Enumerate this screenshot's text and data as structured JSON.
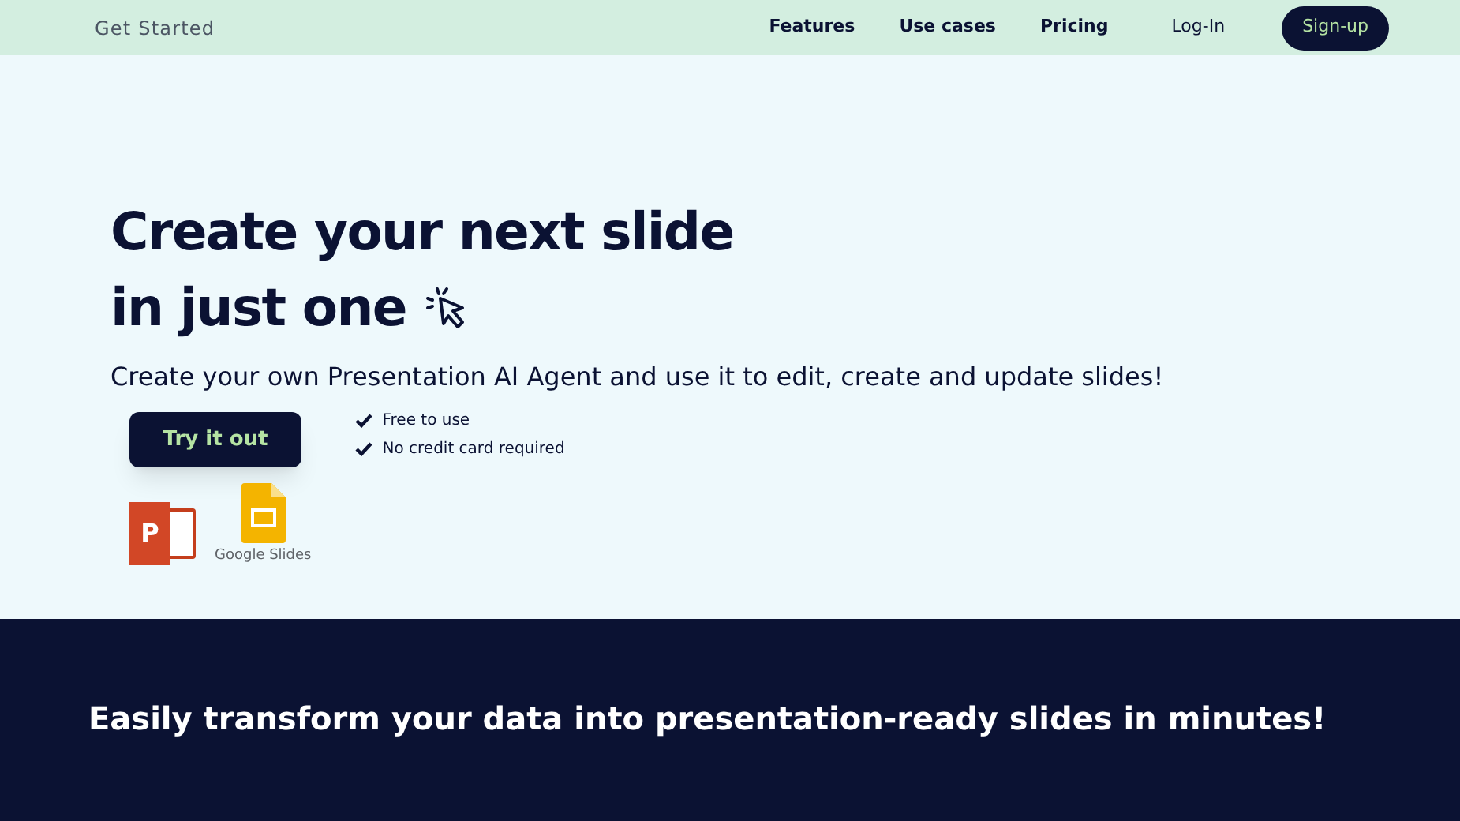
{
  "nav": {
    "brand": "Get Started",
    "links": [
      "Features",
      "Use cases",
      "Pricing"
    ],
    "login": "Log-In",
    "signup": "Sign-up"
  },
  "hero": {
    "title_line1": "Create your next slide",
    "title_line2": "in just one",
    "subtitle": "Create your own Presentation AI Agent and use it to edit, create and update slides!",
    "cta": "Try it out",
    "perks": [
      "Free to use",
      "No credit card required"
    ],
    "powerpoint_letter": "P",
    "slides_label": "Google Slides"
  },
  "section": {
    "heading": "Easily transform your data into presentation-ready slides in minutes!"
  }
}
